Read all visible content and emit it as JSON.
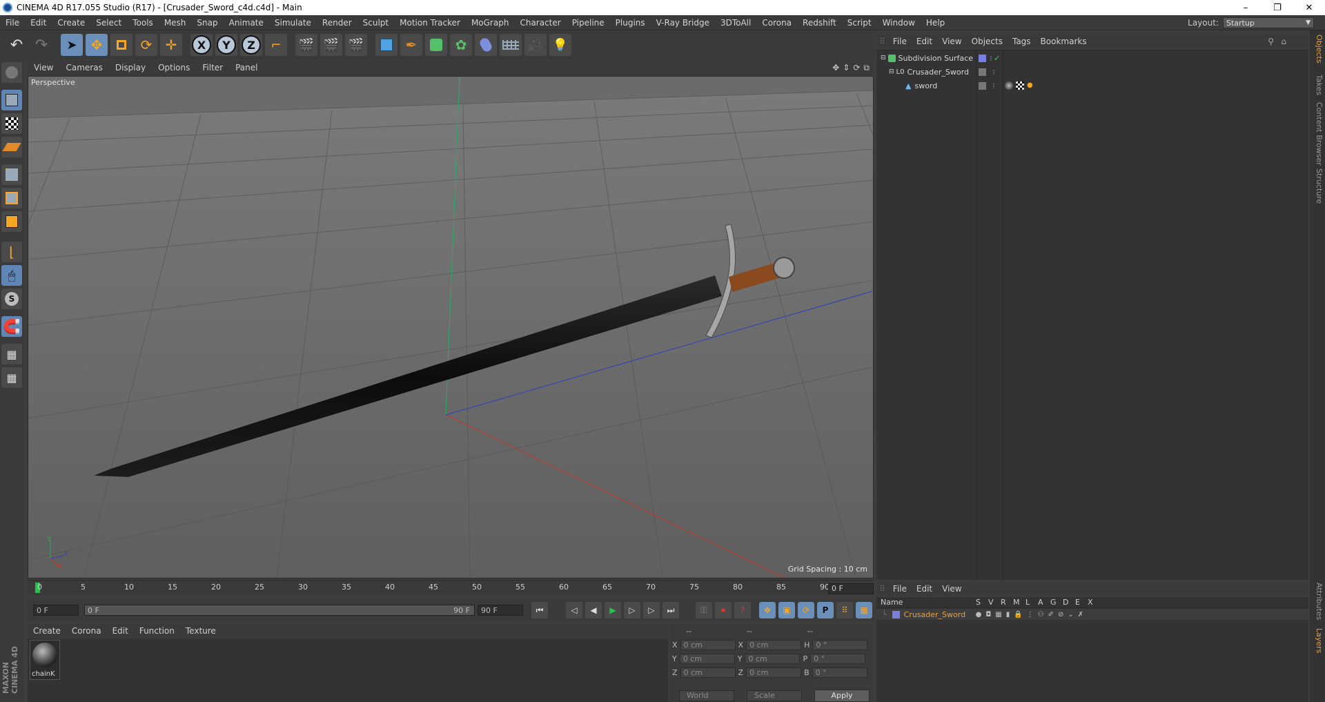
{
  "window": {
    "title": "CINEMA 4D R17.055 Studio (R17) - [Crusader_Sword_c4d.c4d] - Main",
    "minimize": "–",
    "restore": "❐",
    "close": "✕"
  },
  "menubar": {
    "items": [
      "File",
      "Edit",
      "Create",
      "Select",
      "Tools",
      "Mesh",
      "Snap",
      "Animate",
      "Simulate",
      "Render",
      "Sculpt",
      "Motion Tracker",
      "MoGraph",
      "Character",
      "Pipeline",
      "Plugins",
      "V-Ray Bridge",
      "3DToAll",
      "Corona",
      "Redshift",
      "Script",
      "Window",
      "Help"
    ],
    "layout_label": "Layout:",
    "layout_value": "Startup"
  },
  "toolbar": {
    "axis_x": "X",
    "axis_y": "Y",
    "axis_z": "Z"
  },
  "viewport": {
    "menu": [
      "View",
      "Cameras",
      "Display",
      "Options",
      "Filter",
      "Panel"
    ],
    "label": "Perspective",
    "grid_spacing": "Grid Spacing : 10 cm",
    "axis_x": "x",
    "axis_y": "y",
    "axis_z": "z"
  },
  "timeline": {
    "ticks": [
      "0",
      "5",
      "10",
      "15",
      "20",
      "25",
      "30",
      "35",
      "40",
      "45",
      "50",
      "55",
      "60",
      "65",
      "70",
      "75",
      "80",
      "85",
      "90"
    ],
    "current_frame": "0 F"
  },
  "playback": {
    "start": "0 F",
    "range_start": "0 F",
    "range_end": "90 F",
    "end": "90 F"
  },
  "object_manager": {
    "menu": [
      "File",
      "Edit",
      "View",
      "Objects",
      "Tags",
      "Bookmarks"
    ],
    "objects": [
      {
        "name": "Subdivision Surface"
      },
      {
        "name": "Crusader_Sword"
      },
      {
        "name": "sword"
      }
    ]
  },
  "layer_manager": {
    "menu": [
      "File",
      "Edit",
      "View"
    ],
    "header": {
      "name": "Name",
      "cols": [
        "S",
        "V",
        "R",
        "M",
        "L",
        "A",
        "G",
        "D",
        "E",
        "X"
      ]
    },
    "layers": [
      {
        "name": "Crusader_Sword"
      }
    ]
  },
  "material_manager": {
    "menu": [
      "Create",
      "Corona",
      "Edit",
      "Function",
      "Texture"
    ],
    "materials": [
      {
        "name": "chainK"
      }
    ]
  },
  "coordinate_manager": {
    "headers": [
      "--",
      "--",
      "--"
    ],
    "rows": [
      {
        "a": "X",
        "av": "0 cm",
        "b": "X",
        "bv": "0 cm",
        "c": "H",
        "cv": "0 °"
      },
      {
        "a": "Y",
        "av": "0 cm",
        "b": "Y",
        "bv": "0 cm",
        "c": "P",
        "cv": "0 °"
      },
      {
        "a": "Z",
        "av": "0 cm",
        "b": "Z",
        "bv": "0 cm",
        "c": "B",
        "cv": "0 °"
      }
    ],
    "world": "World",
    "scale": "Scale",
    "apply": "Apply"
  },
  "side_tabs": [
    "Objects",
    "Takes",
    "Content Browser",
    "Structure",
    "Attributes",
    "Layers"
  ],
  "logo": "MAXON CINEMA 4D",
  "colors": {
    "accent": "#e3a24a",
    "layer_color": "#7a7ee0",
    "axis_x": "#c0392b",
    "axis_y": "#27ae60",
    "axis_z": "#2e3fb8"
  }
}
